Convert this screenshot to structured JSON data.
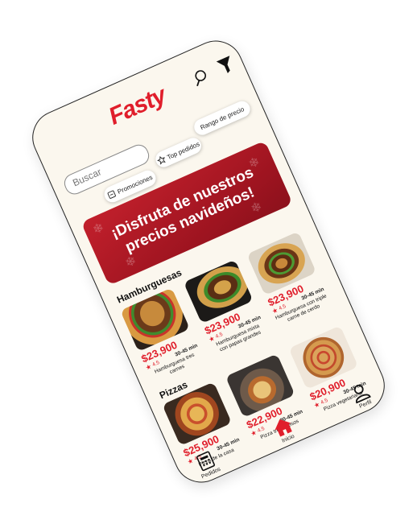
{
  "app": {
    "logo": "Fasty"
  },
  "search": {
    "placeholder": "Buscar"
  },
  "filters": [
    {
      "label": "Rango de precio",
      "icon": ""
    },
    {
      "label": "Top pedidos",
      "icon": "star-outline-icon"
    },
    {
      "label": "Promociones",
      "icon": "tag-icon"
    }
  ],
  "banner": {
    "line1": "¡Disfruta de nuestros",
    "line2": "precios navideños!"
  },
  "sections": {
    "burgers": {
      "title": "Hamburguesas",
      "items": [
        {
          "price": "$23,900",
          "rating": "4.5",
          "time": "30-45 min",
          "name": "Hamburguesa tres carnes"
        },
        {
          "price": "$23,900",
          "rating": "4.5",
          "time": "30-45 min",
          "name": "Hamburguesa mixta con papas grandes"
        },
        {
          "price": "$23,900",
          "rating": "4.5",
          "time": "30-45 min",
          "name": "Hamburguesa con triple carne de cerdo"
        }
      ]
    },
    "pizzas": {
      "title": "Pizzas",
      "items": [
        {
          "price": "$25,900",
          "rating": "4.5",
          "time": "30-45 min",
          "name": "Pizza de la casa"
        },
        {
          "price": "$22,900",
          "rating": "4.5",
          "time": "30-45 min",
          "name": "Pizza tres quesos"
        },
        {
          "price": "$20,900",
          "rating": "4.5",
          "time": "30-45 min",
          "name": "Pizza vegetariana"
        }
      ]
    }
  },
  "nav": {
    "pedidos": "Pedidos",
    "inicio": "Inicio",
    "perfil": "Perfil"
  },
  "colors": {
    "brand": "#e01e2b",
    "background": "#fbf7ee",
    "banner": "#b01a26"
  }
}
